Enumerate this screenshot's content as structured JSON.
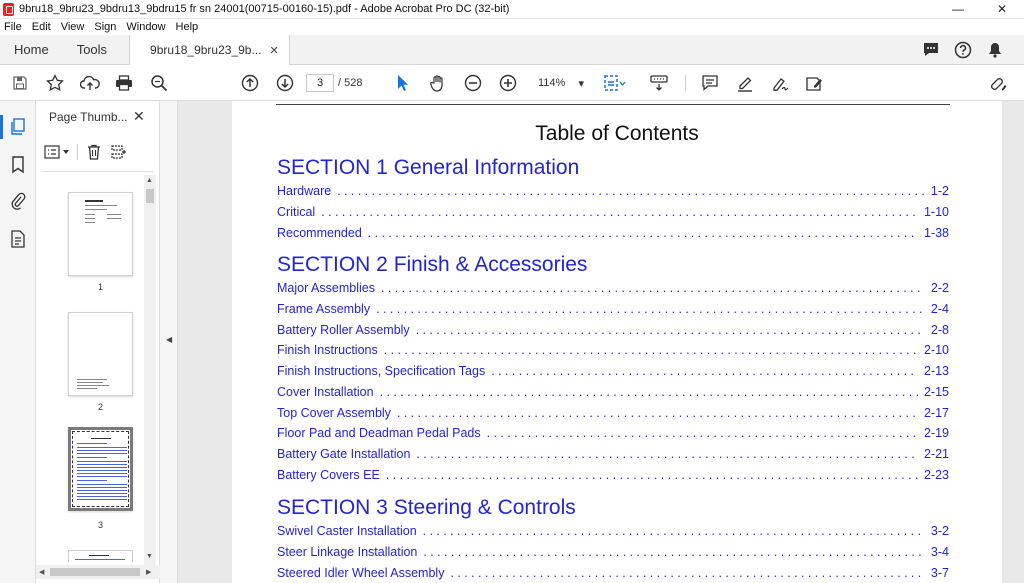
{
  "window": {
    "title": "9bru18_9bru23_9bdru13_9bdru15 fr sn 24001(00715-00160-15).pdf - Adobe Acrobat Pro DC (32-bit)",
    "minimize": "—",
    "close": "✕"
  },
  "menu": [
    "File",
    "Edit",
    "View",
    "Sign",
    "Window",
    "Help"
  ],
  "tabs": {
    "home": "Home",
    "tools": "Tools",
    "document": "9bru18_9bru23_9b...",
    "close": "✕"
  },
  "toolbar": {
    "page_current": "3",
    "page_total": "/ 528",
    "zoom": "114%",
    "zoom_caret": "▾"
  },
  "thumbnails_panel": {
    "title": "Page Thumb...",
    "close": "✕",
    "pages": [
      "1",
      "2",
      "3"
    ]
  },
  "icons": {
    "save": "save-icon",
    "bookmark": "bookmark-icon",
    "upload": "cloud-upload-icon",
    "print": "print-icon",
    "search": "search-icon"
  },
  "colors": {
    "link": "#2323d8",
    "accent": "#1473e6"
  },
  "document": {
    "heading": "Table of Contents",
    "sections": [
      {
        "title": "SECTION 1 General Information",
        "entries": [
          {
            "text": "Hardware",
            "page": "1-2"
          },
          {
            "text": "Critical",
            "page": "1-10"
          },
          {
            "text": "Recommended",
            "page": "1-38"
          }
        ]
      },
      {
        "title": "SECTION 2 Finish & Accessories",
        "entries": [
          {
            "text": "Major Assemblies",
            "page": "2-2"
          },
          {
            "text": "Frame Assembly",
            "page": "2-4"
          },
          {
            "text": "Battery Roller Assembly",
            "page": "2-8"
          },
          {
            "text": "Finish Instructions",
            "page": "2-10"
          },
          {
            "text": "Finish Instructions, Specification Tags",
            "page": "2-13"
          },
          {
            "text": "Cover Installation",
            "page": "2-15"
          },
          {
            "text": "Top Cover Assembly",
            "page": "2-17"
          },
          {
            "text": "Floor Pad and Deadman Pedal Pads",
            "page": "2-19"
          },
          {
            "text": "Battery Gate Installation",
            "page": "2-21"
          },
          {
            "text": "Battery Covers EE",
            "page": "2-23"
          }
        ]
      },
      {
        "title": "SECTION 3 Steering & Controls",
        "entries": [
          {
            "text": "Swivel Caster Installation",
            "page": "3-2"
          },
          {
            "text": "Steer Linkage Installation",
            "page": "3-4"
          },
          {
            "text": "Steered Idler Wheel Assembly",
            "page": "3-7"
          }
        ]
      }
    ]
  }
}
